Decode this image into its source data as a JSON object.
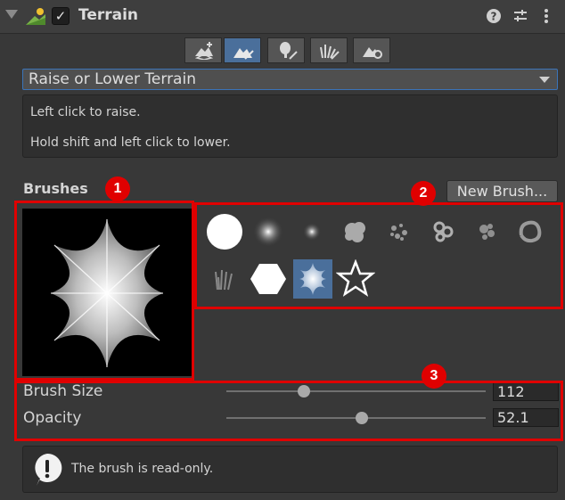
{
  "header": {
    "title": "Terrain",
    "enabled_check": "✓",
    "icons": [
      "foldout-arrow-icon",
      "terrain-icon",
      "help-icon",
      "preset-settings-icon",
      "more-menu-icon"
    ]
  },
  "toolbar": {
    "tools": [
      {
        "name": "create-neighbor-terrains",
        "icon": "terrain-plus-icon",
        "active": false
      },
      {
        "name": "paint-terrain",
        "icon": "brush-mountain-icon",
        "active": true
      },
      {
        "name": "paint-trees",
        "icon": "tree-brush-icon",
        "active": false
      },
      {
        "name": "paint-details",
        "icon": "grass-brush-icon",
        "active": false
      },
      {
        "name": "terrain-settings",
        "icon": "terrain-gear-icon",
        "active": false
      }
    ]
  },
  "tool_select": {
    "value": "Raise or Lower Terrain"
  },
  "description": {
    "line1": "Left click to raise.",
    "line2": "Hold shift and left click to lower."
  },
  "brushes": {
    "label": "Brushes",
    "new_brush_label": "New Brush...",
    "selected_index": 10,
    "items": [
      "hard-circle",
      "soft-circle",
      "small-soft-circle",
      "cloud",
      "noise-1",
      "noise-2",
      "noise-3",
      "ring-noise",
      "grass-strokes",
      "hexagon",
      "star-soft",
      "star-outline"
    ]
  },
  "settings": {
    "brush_size": {
      "label": "Brush Size",
      "value": "112",
      "fraction": 0.3
    },
    "opacity": {
      "label": "Opacity",
      "value": "52.1",
      "fraction": 0.521
    }
  },
  "help": {
    "text": "The brush is read-only.",
    "icon": "exclamation-bubble-icon"
  },
  "annotations": {
    "badge1": "1",
    "badge2": "2",
    "badge3": "3"
  },
  "colors": {
    "highlight": "#e00000",
    "selected": "#4a6f9b",
    "background": "#383838"
  }
}
